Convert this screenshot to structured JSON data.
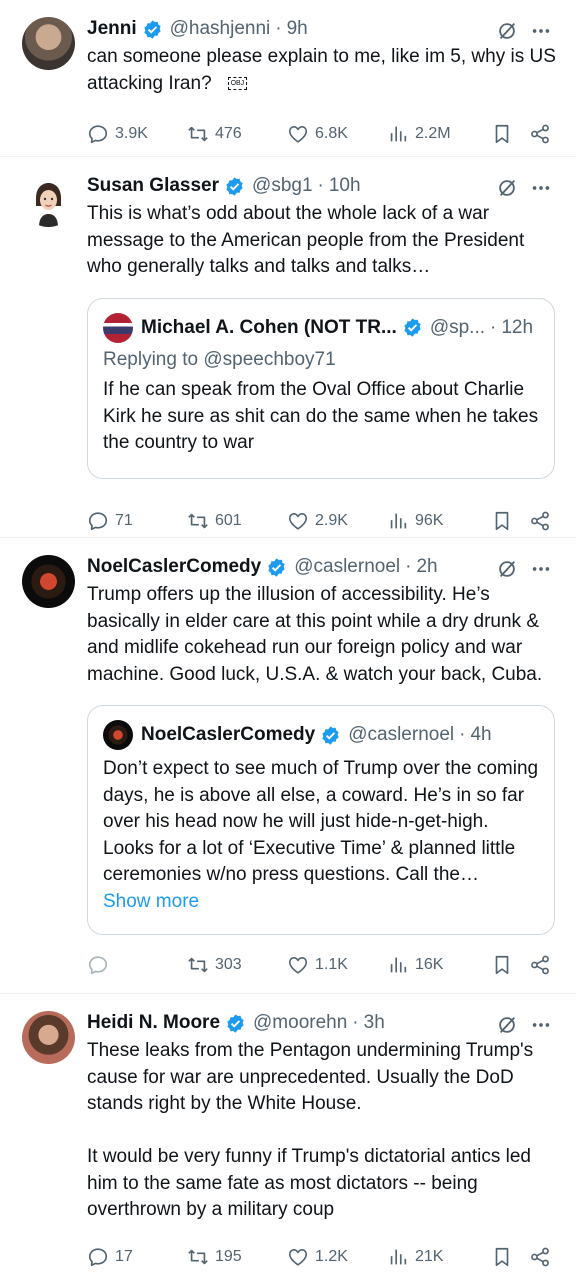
{
  "colors": {
    "accent": "#1d9bf0",
    "muted": "#536471",
    "text": "#0f1419"
  },
  "tweets": [
    {
      "name": "Jenni",
      "handle": "@hashjenni",
      "time": "9h",
      "text": "can someone please explain to me, like im 5, why is US attacking Iran?⠀",
      "obj_glyph": "OBJ",
      "stats": {
        "replies": "3.9K",
        "reposts": "476",
        "likes": "6.8K",
        "views": "2.2M"
      }
    },
    {
      "name": "Susan Glasser",
      "handle": "@sbg1",
      "time": "10h",
      "text": "This is what’s odd about the whole lack of a war message to the American people from the President who generally talks and talks and talks…",
      "quote": {
        "name": "Michael A. Cohen (NOT TR...",
        "handle": "@sp...",
        "time": "12h",
        "replying": "Replying to @speechboy71",
        "text": "If he can speak from the Oval Office about Charlie Kirk he sure as shit can do the same when he takes the country to war"
      },
      "stats": {
        "replies": "71",
        "reposts": "601",
        "likes": "2.9K",
        "views": "96K"
      }
    },
    {
      "name": "NoelCaslerComedy",
      "handle": "@caslernoel",
      "time": "2h",
      "text": "Trump offers up the illusion of accessibility. He’s basically in elder care at this point while a dry drunk & and midlife cokehead run our foreign policy and war machine. Good luck, U.S.A. & watch your back, Cuba.",
      "quote": {
        "name": "NoelCaslerComedy",
        "handle": "@caslernoel",
        "time": "4h",
        "text": "Don’t expect to see much of Trump over the coming days, he is above all else, a coward. He’s in so far over his head now he will just hide-n-get-high. Looks for a lot of ‘Executive Time’ & planned little ceremonies w/no press questions. Call the…",
        "show_more": "Show more"
      },
      "stats": {
        "replies": "",
        "reposts": "303",
        "likes": "1.1K",
        "views": "16K"
      }
    },
    {
      "name": "Heidi N. Moore",
      "handle": "@moorehn",
      "time": "3h",
      "text": "These leaks from the Pentagon undermining Trump's cause for war are unprecedented. Usually the DoD stands right by the White House.\n\nIt would be very funny if Trump's dictatorial antics led him to the same fate as most dictators -- being overthrown by a military coup",
      "stats": {
        "replies": "17",
        "reposts": "195",
        "likes": "1.2K",
        "views": "21K"
      }
    }
  ],
  "icons": [
    "verified-badge-icon",
    "grok-icon",
    "more-icon",
    "reply-icon",
    "repost-icon",
    "like-icon",
    "views-icon",
    "bookmark-icon",
    "share-icon"
  ]
}
